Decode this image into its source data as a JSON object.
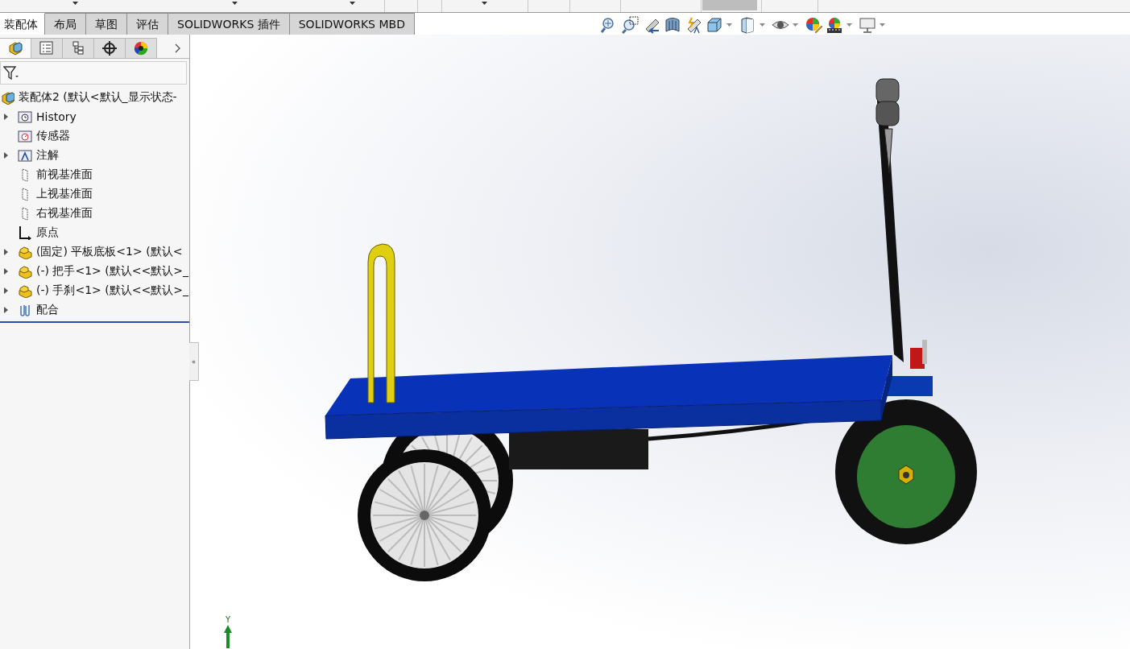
{
  "command_tabs": [
    {
      "label": "装配体",
      "selected": true
    },
    {
      "label": "布局",
      "selected": false
    },
    {
      "label": "草图",
      "selected": false
    },
    {
      "label": "评估",
      "selected": false
    },
    {
      "label": "SOLIDWORKS 插件",
      "selected": false
    },
    {
      "label": "SOLIDWORKS MBD",
      "selected": false
    }
  ],
  "panel_tabs": [
    {
      "kind": "tree",
      "selected": true
    },
    {
      "kind": "properties",
      "selected": false
    },
    {
      "kind": "configurations",
      "selected": false
    },
    {
      "kind": "target",
      "selected": false
    },
    {
      "kind": "appearance",
      "selected": false
    }
  ],
  "tree": {
    "label": "装配体2  (默认<默认_显示状态-",
    "kind": "assembly",
    "children": [
      {
        "label": "History",
        "kind": "history",
        "expandable": true
      },
      {
        "label": "传感器",
        "kind": "sensor",
        "expandable": false
      },
      {
        "label": "注解",
        "kind": "annotation",
        "expandable": true
      },
      {
        "label": "前视基准面",
        "kind": "plane",
        "expandable": false
      },
      {
        "label": "上视基准面",
        "kind": "plane",
        "expandable": false
      },
      {
        "label": "右视基准面",
        "kind": "plane",
        "expandable": false
      },
      {
        "label": "原点",
        "kind": "origin",
        "expandable": false
      },
      {
        "label": "(固定) 平板底板<1> (默认<",
        "kind": "part",
        "expandable": true
      },
      {
        "label": "(-) 把手<1> (默认<<默认>_",
        "kind": "part",
        "expandable": true
      },
      {
        "label": "(-) 手刹<1> (默认<<默认>_",
        "kind": "part",
        "expandable": true
      },
      {
        "label": "配合",
        "kind": "mates",
        "expandable": true
      }
    ]
  },
  "triad": {
    "label": "Y"
  }
}
